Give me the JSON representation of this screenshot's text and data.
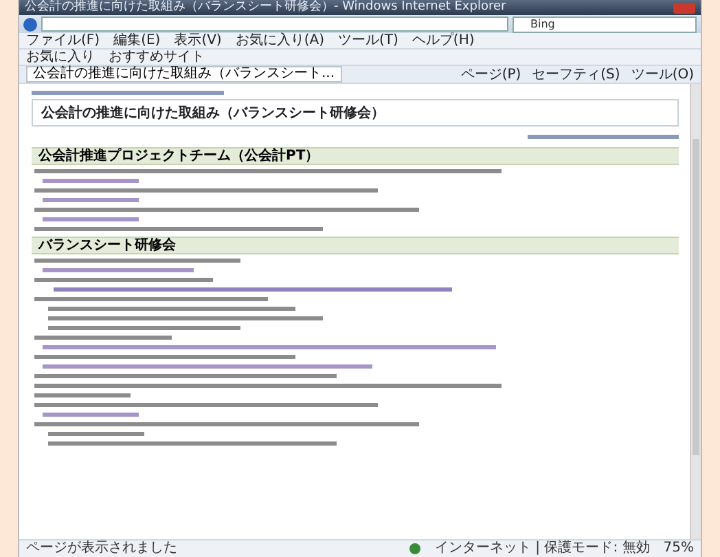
{
  "window": {
    "title": "公会計の推進に向けた取組み（バランスシート研修会）- Windows Internet Explorer"
  },
  "search": {
    "value": "Bing"
  },
  "menu": [
    "ファイル(F)",
    "編集(E)",
    "表示(V)",
    "お気に入り(A)",
    "ツール(T)",
    "ヘルプ(H)"
  ],
  "favorites": [
    "お気に入り",
    "おすすめサイト"
  ],
  "tab": {
    "label": "公会計の推進に向けた取組み（バランスシート..."
  },
  "commands": [
    "ページ(P)",
    "セーフティ(S)",
    "ツール(O)"
  ],
  "page": {
    "heading": "公会計の推進に向けた取組み（バランスシート研修会）",
    "sections": [
      {
        "title": "公会計推進プロジェクトチーム（公会計PT）",
        "lines": [
          {
            "kind": "text"
          },
          {
            "kind": "link"
          },
          {
            "kind": "text"
          },
          {
            "kind": "link"
          },
          {
            "kind": "text"
          },
          {
            "kind": "link"
          },
          {
            "kind": "text"
          }
        ]
      },
      {
        "title": "バランスシート研修会",
        "lines": [
          {
            "kind": "text"
          },
          {
            "kind": "link"
          },
          {
            "kind": "text"
          },
          {
            "kind": "bullet"
          },
          {
            "kind": "text"
          },
          {
            "kind": "indent"
          },
          {
            "kind": "indent"
          },
          {
            "kind": "indent"
          },
          {
            "kind": "text"
          },
          {
            "kind": "link"
          },
          {
            "kind": "text"
          },
          {
            "kind": "link"
          },
          {
            "kind": "text"
          },
          {
            "kind": "text"
          },
          {
            "kind": "text"
          },
          {
            "kind": "text"
          },
          {
            "kind": "link"
          },
          {
            "kind": "text"
          },
          {
            "kind": "indent"
          },
          {
            "kind": "indent"
          }
        ]
      }
    ]
  },
  "status_bar": {
    "message": "ページが表示されました",
    "zone": "インターネット | 保護モード: 無効",
    "zoom": "75%"
  }
}
